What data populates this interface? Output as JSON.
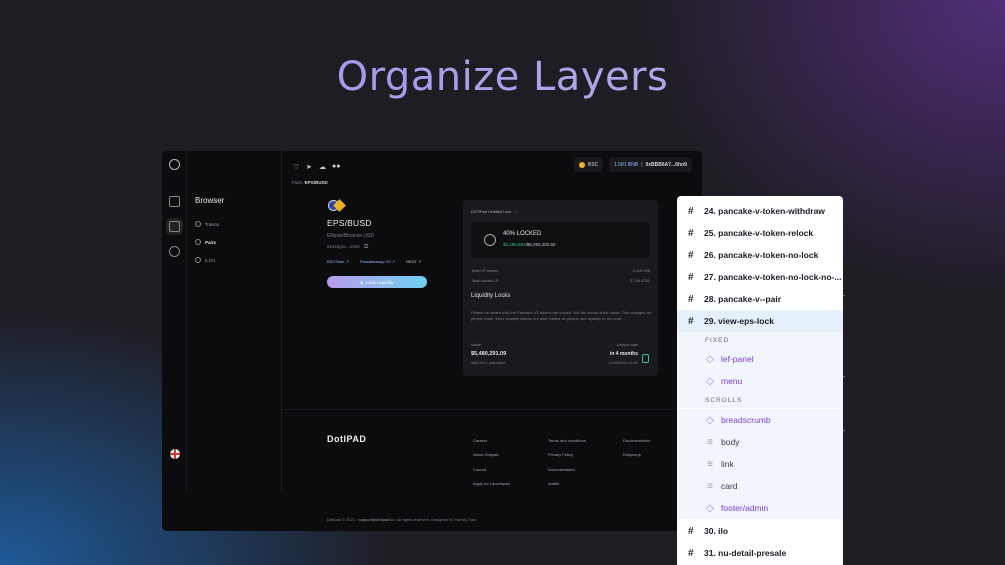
{
  "headline": "Organize Layers",
  "app": {
    "rail": {
      "icons": [
        "dotipad-logo-icon",
        "grid-icon",
        "network-icon",
        "gear-icon"
      ]
    },
    "panel": {
      "title": "Browser",
      "items": [
        {
          "label": "Tokens",
          "icon": "token-icon",
          "selected": false
        },
        {
          "label": "Pairs",
          "icon": "pairs-icon",
          "selected": true
        },
        {
          "label": "ILO's",
          "icon": "ilo-icon",
          "selected": false
        }
      ]
    },
    "topbar": {
      "network": "BSC",
      "balance": "1.581 BNB",
      "address": "0xBBB6A7...6hn9"
    },
    "breadcrumb": {
      "prefix": "Pairs /",
      "current": "EPS/BUSD"
    },
    "pair": {
      "name": "EPS/BUSD",
      "subtitle": "Ellipsis/Binance USD",
      "address": "0x42dgsc...s942",
      "links": [
        "BSCScan",
        "Pancakeswap V2",
        "DEXT"
      ],
      "lock_button": "Lock Liquidity"
    },
    "card": {
      "certified": "DOTIPad Certified Lock",
      "locked_percent": "40% LOCKED",
      "locked_value": "$2,196,881",
      "locked_total": "/$5,492,202.50",
      "total_lp_label": "Total LP tokens",
      "total_lp_value": "3,119.908",
      "locked_lp_label": "Total locked LP",
      "locked_lp_value": "2,746.4781",
      "section_title": "Liquidity Locks",
      "description": "Please be aware only the Pancake V2 tokens are locked. Not the actual dollar value. This changes as people trade. More liquidity tokens are also minted as people add liquidity to the pool.",
      "value_label": "Value",
      "value": "$5,480,291.09",
      "value_sub": "548,029.1 pancake2",
      "unlock_label": "Unlock date",
      "unlock_value": "in 4 months",
      "unlock_date": "11/05/2021 02:00"
    },
    "footer": {
      "logo": "DotIPAD",
      "col1": [
        "Careers",
        "About Dotipad",
        "Council",
        "Apply for Launchpad"
      ],
      "col2": [
        "Terms and conditions",
        "Privacy Policy",
        "Documentation",
        "Audits"
      ],
      "col3": [
        "Documentation",
        "Dotipad.js"
      ],
      "copyright_prefix": "DotIpad © 2021 •",
      "email": "support@dotipad.io",
      "copyright_suffix": "• All rights reserved. Designed by Twenty-Two"
    }
  },
  "layers": {
    "rows": [
      {
        "label": "24. pancake-v-token-withdraw"
      },
      {
        "label": "25. pancake-v-token-relock"
      },
      {
        "label": "26. pancake-v-token-no-lock"
      },
      {
        "label": "27. pancake-v-token-no-lock-no-..."
      },
      {
        "label": "28. pancake-v--pair"
      },
      {
        "label": "29. view-eps-lock"
      }
    ],
    "fixed_header": "FIXED",
    "fixed_items": [
      {
        "label": "lef-panel",
        "kind": "component"
      },
      {
        "label": "menu",
        "kind": "component"
      }
    ],
    "scrolls_header": "SCROLLS",
    "scroll_items": [
      {
        "label": "breadscrumb",
        "kind": "component"
      },
      {
        "label": "body",
        "kind": "text"
      },
      {
        "label": "link",
        "kind": "text"
      },
      {
        "label": "card",
        "kind": "text"
      },
      {
        "label": "footer/admin",
        "kind": "component"
      }
    ],
    "bottom_rows": [
      {
        "label": "30. ilo"
      },
      {
        "label": "31. nu-detail-presale"
      }
    ],
    "colors": {
      "selected_bg": "#e6f0fb",
      "component": "#7d3fd3"
    }
  }
}
